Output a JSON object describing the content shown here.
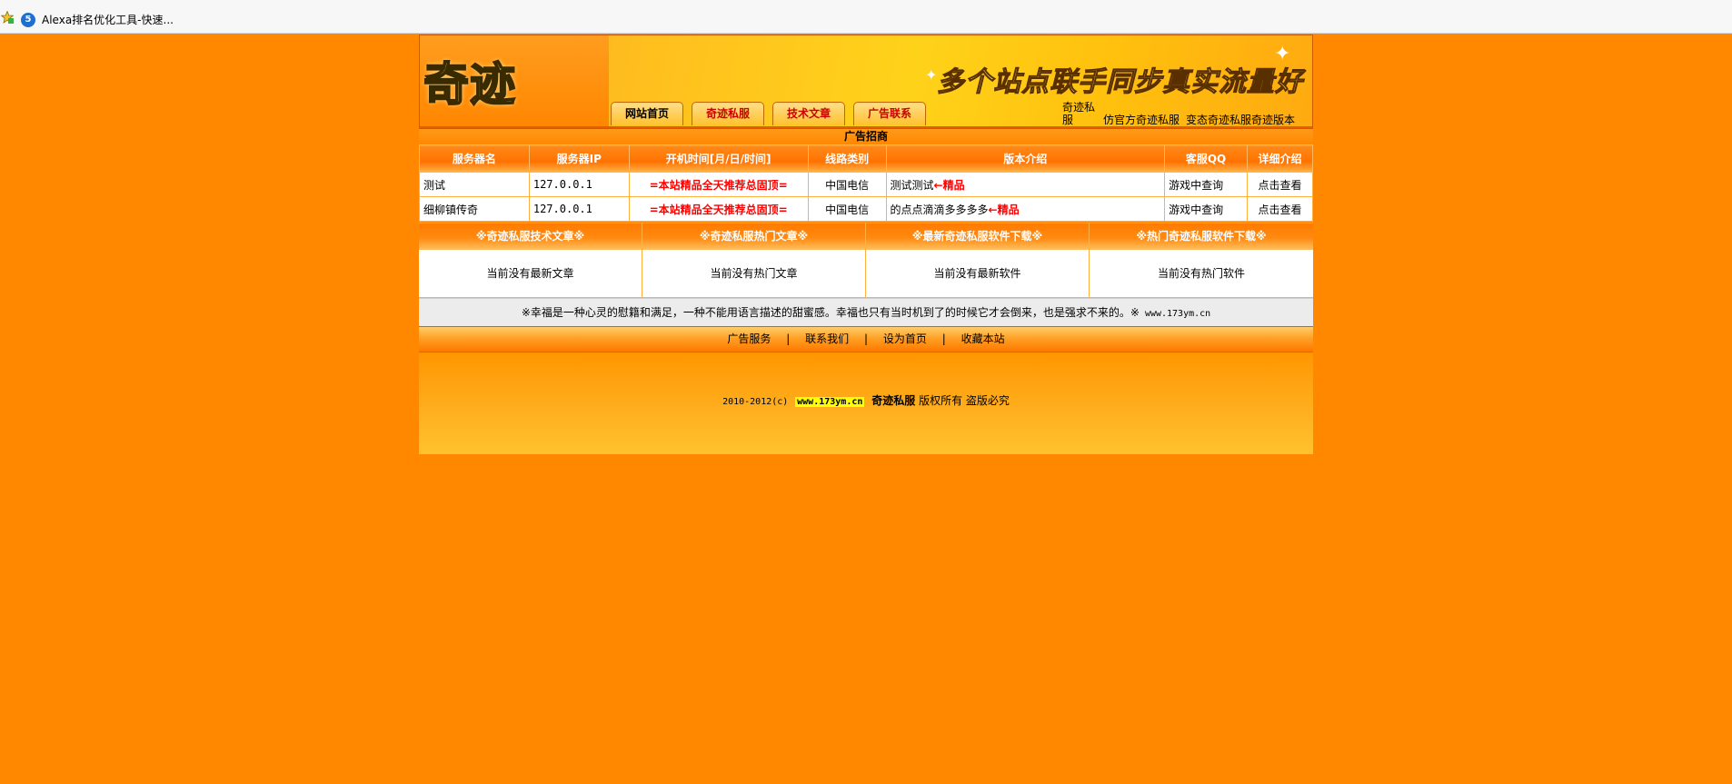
{
  "favorites_bar": {
    "star_icon": "favorites-star-icon",
    "item_badge": "5",
    "item_label": "Alexa排名优化工具-快速..."
  },
  "header": {
    "logo_text": "奇迹",
    "slogan": "多个站点联手同步真实流量好",
    "nav": [
      "网站首页",
      "奇迹私服",
      "技术文章",
      "广告联系"
    ],
    "links": [
      "奇迹私服",
      "仿官方奇迹私服",
      "变态奇迹私服奇迹版本"
    ]
  },
  "ad_title": "广告招商",
  "servers": {
    "columns": [
      "服务器名",
      "服务器IP",
      "开机时间[月/日/时间]",
      "线路类别",
      "版本介绍",
      "客服QQ",
      "详细介绍"
    ],
    "rows": [
      {
        "name": "测试",
        "ip": "127.0.0.1",
        "time": "=本站精品全天推荐总固顶=",
        "line": "中国电信",
        "version": "测试测试",
        "tag": "←精品",
        "qq": "游戏中查询",
        "detail": "点击查看"
      },
      {
        "name": "细柳镇传奇",
        "ip": "127.0.0.1",
        "time": "=本站精品全天推荐总固顶=",
        "line": "中国电信",
        "version": "的点点滴滴多多多多",
        "tag": "←精品",
        "qq": "游戏中查询",
        "detail": "点击查看"
      }
    ]
  },
  "articles": [
    {
      "title": "※奇迹私服技术文章※",
      "empty": "当前没有最新文章"
    },
    {
      "title": "※奇迹私服热门文章※",
      "empty": "当前没有热门文章"
    },
    {
      "title": "※最新奇迹私服软件下载※",
      "empty": "当前没有最新软件"
    },
    {
      "title": "※热门奇迹私服软件下载※",
      "empty": "当前没有热门软件"
    }
  ],
  "quote": {
    "text": "※幸福是一种心灵的慰籍和满足，一种不能用语言描述的甜蜜感。幸福也只有当时机到了的时候它才会倒来，也是强求不来的。※",
    "url": "www.173ym.cn"
  },
  "footer_nav": {
    "links": [
      "广告服务",
      "联系我们",
      "设为首页",
      "收藏本站"
    ],
    "separator": "|"
  },
  "copyright": {
    "years": "2010-2012(c)",
    "domain": "www.173ym.cn",
    "site_name": "奇迹私服",
    "rights": "版权所有",
    "warning": "盗版必究"
  },
  "colors": {
    "page_bg": "#ff8800",
    "table_head": "#ff7200",
    "highlight_red": "#ff0000",
    "domain_highlight": "#ffff00"
  }
}
